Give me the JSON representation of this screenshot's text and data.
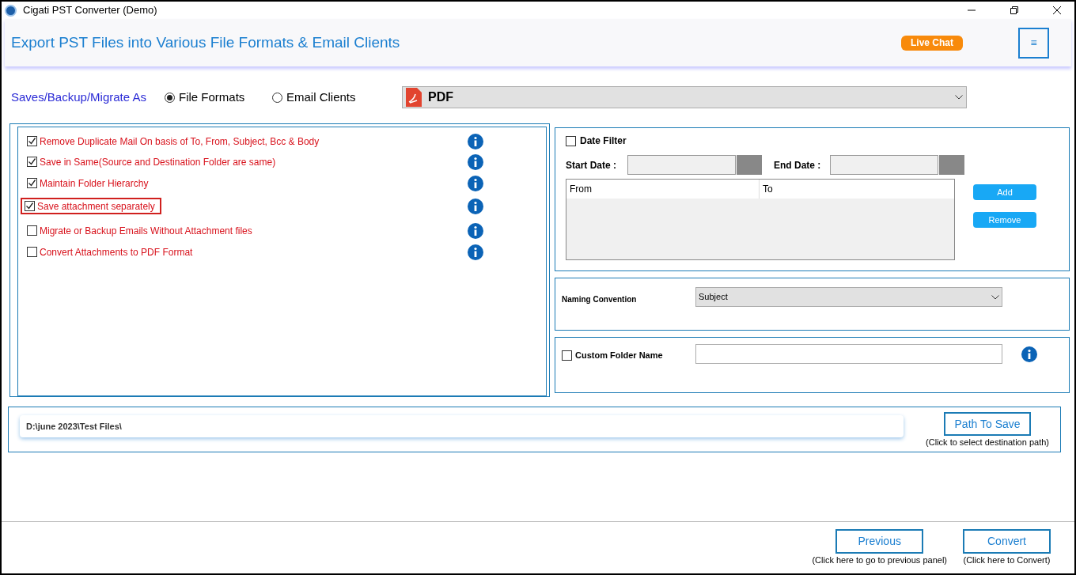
{
  "window": {
    "title": "Cigati PST Converter (Demo)"
  },
  "header": {
    "title": "Export PST Files into Various File Formats & Email Clients",
    "live_chat": "Live Chat",
    "menu_button": "≡"
  },
  "save_as": {
    "label": "Saves/Backup/Migrate As",
    "choices": [
      {
        "label": "File Formats",
        "selected": true
      },
      {
        "label": "Email Clients",
        "selected": false
      }
    ],
    "format": "PDF"
  },
  "options": [
    {
      "label": "Remove Duplicate Mail On basis of To, From, Subject, Bcc & Body",
      "checked": true,
      "highlighted": false
    },
    {
      "label": "Save in Same(Source and Destination Folder are same)",
      "checked": true,
      "highlighted": false
    },
    {
      "label": "Maintain Folder Hierarchy",
      "checked": true,
      "highlighted": false
    },
    {
      "label": "Save attachment separately",
      "checked": true,
      "highlighted": true
    },
    {
      "label": "Migrate or Backup Emails Without Attachment files",
      "checked": false,
      "highlighted": false
    },
    {
      "label": "Convert Attachments to PDF Format",
      "checked": false,
      "highlighted": false
    }
  ],
  "date_filter": {
    "label": "Date Filter",
    "checked": false,
    "start_label": "Start Date :",
    "end_label": "End Date :",
    "columns": [
      "From",
      "To"
    ],
    "add": "Add",
    "remove": "Remove"
  },
  "naming": {
    "label": "Naming Convention",
    "value": "Subject"
  },
  "custom_folder": {
    "label": "Custom Folder Name",
    "checked": false
  },
  "path": {
    "value": "D:\\june 2023\\Test Files\\",
    "button": "Path To Save",
    "hint": "(Click to select destination path)"
  },
  "footer": [
    {
      "button": "Previous",
      "hint": "(Click here to go to previous panel)"
    },
    {
      "button": "Convert",
      "hint": "(Click here to Convert)"
    }
  ]
}
